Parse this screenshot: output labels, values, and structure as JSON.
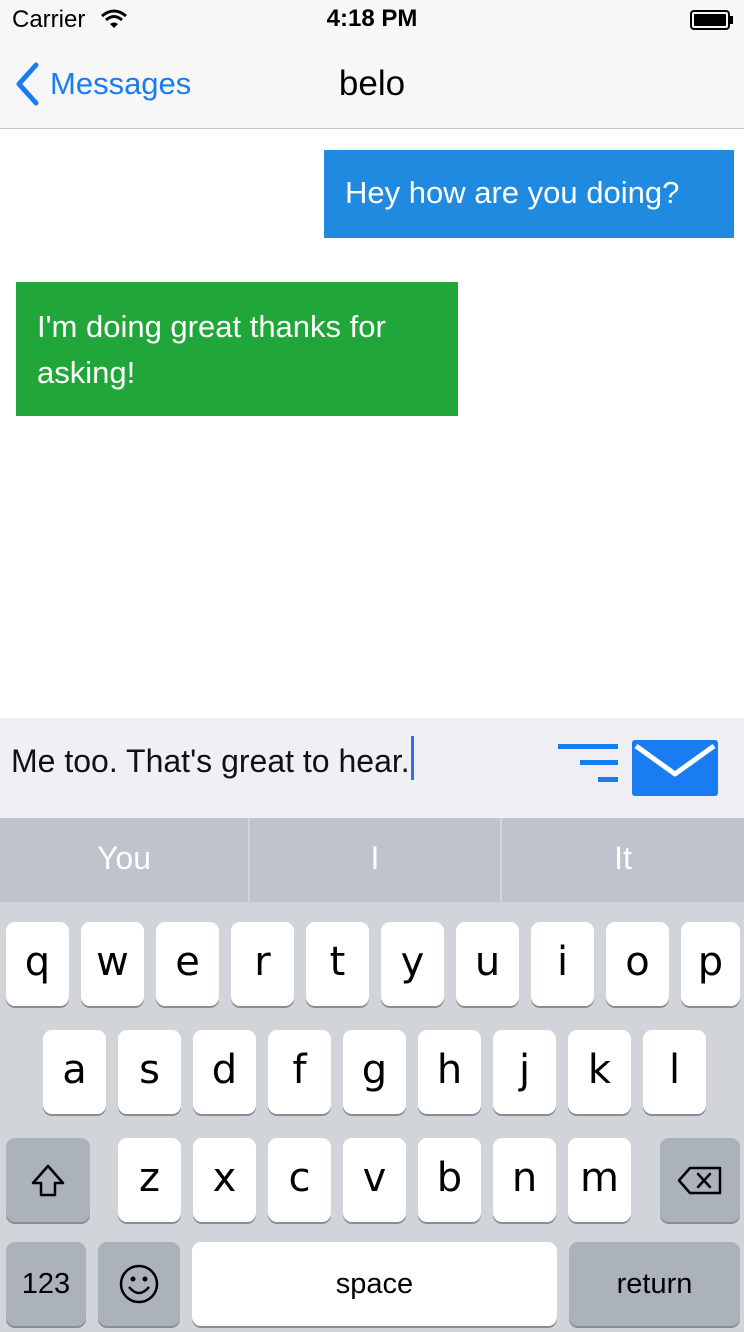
{
  "status_bar": {
    "carrier": "Carrier",
    "time": "4:18 PM"
  },
  "nav": {
    "back_label": "Messages",
    "title": "belo"
  },
  "messages": [
    {
      "direction": "sent",
      "text": "Hey how are you doing?"
    },
    {
      "direction": "received",
      "text": "I'm doing great thanks for asking!"
    }
  ],
  "composer": {
    "text": "Me too. That's great to hear."
  },
  "keyboard": {
    "suggestions": [
      "You",
      "I",
      "It"
    ],
    "rows": [
      [
        "q",
        "w",
        "e",
        "r",
        "t",
        "y",
        "u",
        "i",
        "o",
        "p"
      ],
      [
        "a",
        "s",
        "d",
        "f",
        "g",
        "h",
        "j",
        "k",
        "l"
      ],
      [
        "z",
        "x",
        "c",
        "v",
        "b",
        "n",
        "m"
      ]
    ],
    "numbers_label": "123",
    "space_label": "space",
    "return_label": "return"
  },
  "colors": {
    "accent": "#1a7cf2",
    "sent_bubble": "#1f8ae0",
    "received_bubble": "#21a63a",
    "send_icon": "#1a7cf2"
  },
  "icons": [
    "wifi-icon",
    "battery-icon",
    "back-chevron-icon",
    "menu-lines-icon",
    "send-envelope-icon",
    "shift-icon",
    "emoji-icon",
    "delete-icon"
  ]
}
